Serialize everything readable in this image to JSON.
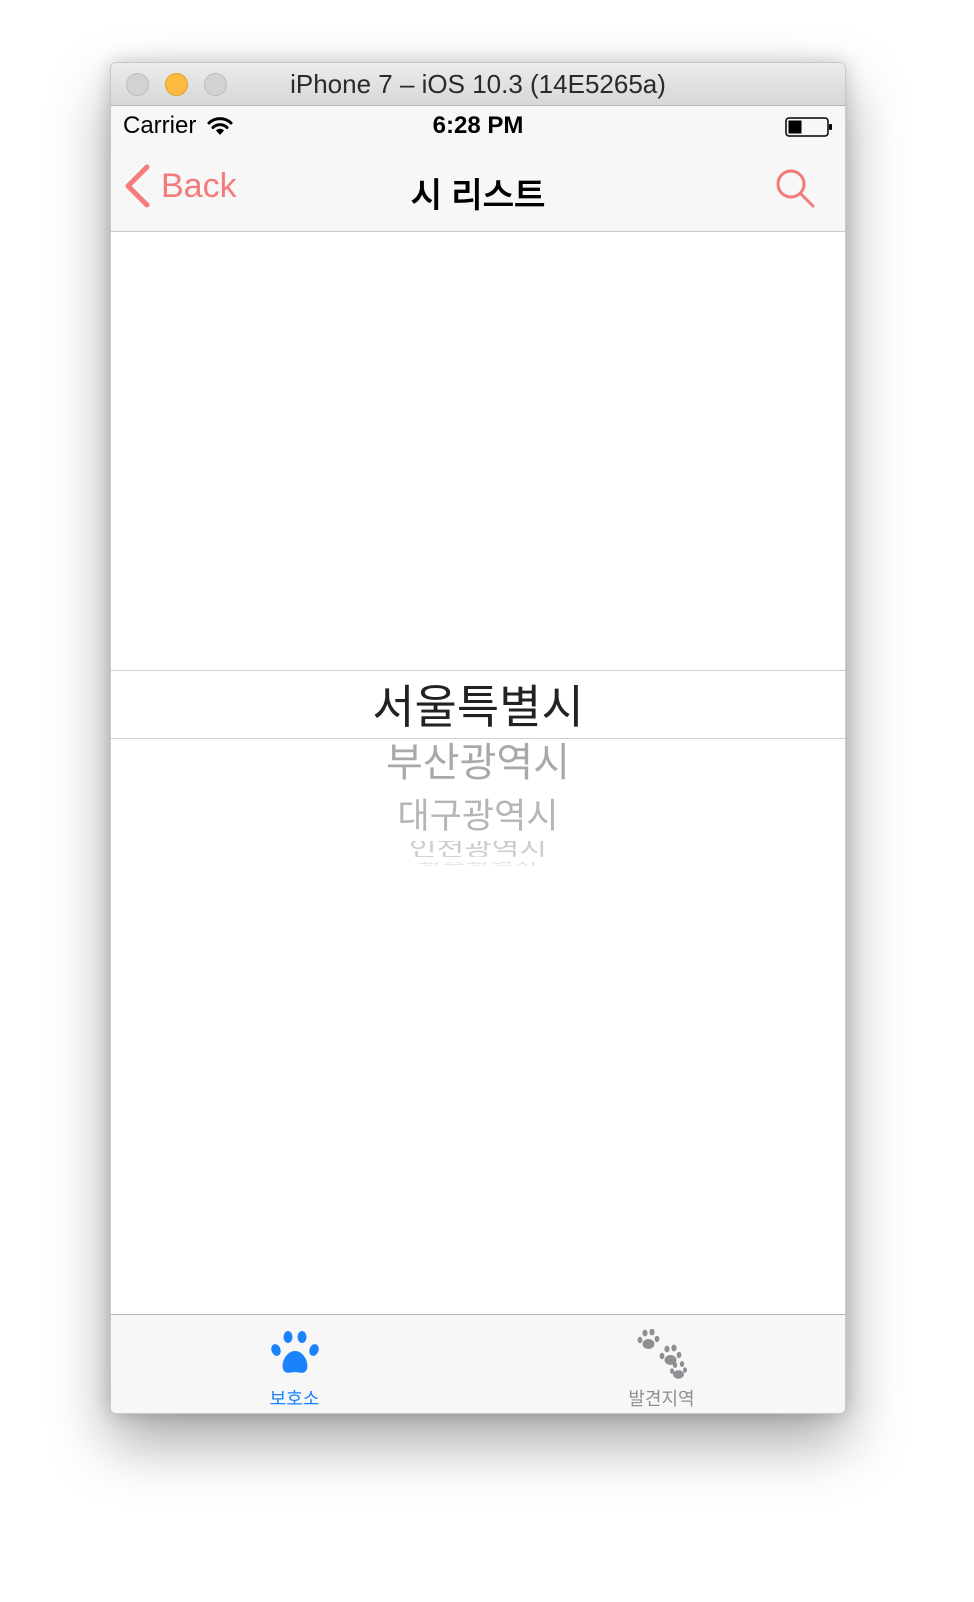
{
  "window": {
    "title": "iPhone 7 – iOS 10.3 (14E5265a)"
  },
  "status_bar": {
    "carrier": "Carrier",
    "time": "6:28 PM",
    "icons": [
      "wifi-icon",
      "battery-icon"
    ]
  },
  "nav": {
    "back_label": "Back",
    "title": "시 리스트",
    "right_icon": "search-icon"
  },
  "picker": {
    "selected": "서울특별시",
    "items": [
      "부산광역시",
      "대구광역시",
      "인천광역시",
      "광주광역시"
    ]
  },
  "tabbar": {
    "tabs": [
      {
        "label": "보호소",
        "icon": "paw-icon",
        "selected": true
      },
      {
        "label": "발견지역",
        "icon": "paws-icon",
        "selected": false
      }
    ]
  },
  "colors": {
    "accent": "#f47b7b",
    "tab_selected": "#1a82fb",
    "tab_unselected": "#8e8e93"
  }
}
